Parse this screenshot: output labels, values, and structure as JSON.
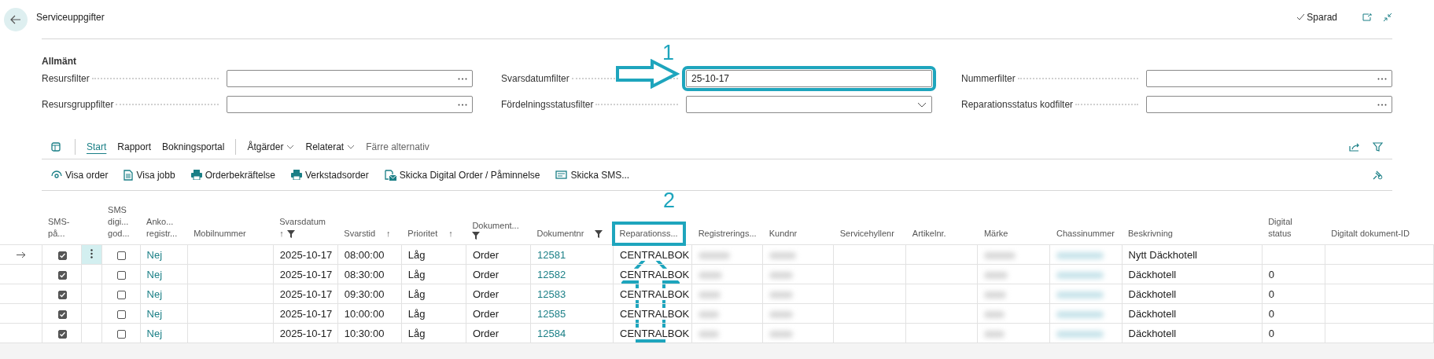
{
  "header": {
    "title": "Serviceuppgifter",
    "status": "Sparad"
  },
  "filters": {
    "group_title": "Allmänt",
    "fields": [
      {
        "label": "Resursfilter",
        "kind": "lookup",
        "highlighted": false
      },
      {
        "label": "Svarsdatumfilter",
        "value": "25-10-17",
        "kind": "text",
        "highlighted": true
      },
      {
        "label": "Nummerfilter",
        "kind": "lookup",
        "highlighted": false
      },
      {
        "label": "Resursgruppfilter",
        "kind": "lookup",
        "highlighted": false
      },
      {
        "label": "Fördelningsstatusfilter",
        "kind": "dropdown",
        "highlighted": false
      },
      {
        "label": "Reparationsstatus kodfilter",
        "kind": "lookup",
        "highlighted": false
      }
    ]
  },
  "nav": [
    {
      "label": "Start",
      "kind": "tab",
      "selected": true
    },
    {
      "label": "Rapport",
      "kind": "tab",
      "selected": false
    },
    {
      "label": "Bokningsportal",
      "kind": "tab",
      "selected": false
    },
    {
      "label": "Åtgärder",
      "kind": "menu",
      "selected": false
    },
    {
      "label": "Relaterat",
      "kind": "menu",
      "selected": false
    },
    {
      "label": "Färre alternativ",
      "kind": "toggle",
      "selected": false
    }
  ],
  "actions": [
    "Visa order",
    "Visa jobb",
    "Orderbekräftelse",
    "Verkstadsorder",
    "Skicka Digital Order / Påminnelse",
    "Skicka SMS..."
  ],
  "table": {
    "columns": [
      {
        "lines": [
          "SMS-",
          "på..."
        ],
        "kind": "check",
        "filter": false,
        "highlighted": false
      },
      {
        "lines": [
          "SMS",
          "digi...",
          "god..."
        ],
        "kind": "check",
        "filter": false,
        "highlighted": false
      },
      {
        "lines": [
          "Anko...",
          "registr..."
        ],
        "kind": "link",
        "filter": false,
        "highlighted": false
      },
      {
        "lines": [
          "Mobilnummer"
        ],
        "kind": "text",
        "filter": false,
        "highlighted": false
      },
      {
        "lines": [
          "Svarsdatum"
        ],
        "sort": "↑",
        "kind": "text",
        "filter": true,
        "highlighted": false
      },
      {
        "lines": [
          "Svarstid"
        ],
        "sort": "↑",
        "kind": "text",
        "filter": false,
        "highlighted": false
      },
      {
        "lines": [
          "Prioritet"
        ],
        "sort": "↑",
        "kind": "text",
        "filter": false,
        "highlighted": false
      },
      {
        "lines": [
          "Dokument..."
        ],
        "kind": "text",
        "filter": true,
        "highlighted": false
      },
      {
        "lines": [
          "Dokumentnr"
        ],
        "kind": "link",
        "filter": true,
        "highlighted": false
      },
      {
        "lines": [
          "Reparationss..."
        ],
        "kind": "text",
        "filter": false,
        "highlighted": true
      },
      {
        "lines": [
          "Registrerings..."
        ],
        "kind": "blurred",
        "filter": false,
        "highlighted": false
      },
      {
        "lines": [
          "Kundnr"
        ],
        "kind": "blurred",
        "filter": false,
        "highlighted": false
      },
      {
        "lines": [
          "Servicehyllenr"
        ],
        "kind": "text",
        "filter": false,
        "highlighted": false
      },
      {
        "lines": [
          "Artikelnr."
        ],
        "kind": "text",
        "filter": false,
        "highlighted": false
      },
      {
        "lines": [
          "Märke"
        ],
        "kind": "blurred",
        "filter": false,
        "highlighted": false
      },
      {
        "lines": [
          "Chassinummer"
        ],
        "kind": "blurred_link",
        "filter": false,
        "highlighted": false
      },
      {
        "lines": [
          "Beskrivning"
        ],
        "kind": "text",
        "filter": false,
        "highlighted": false
      },
      {
        "lines": [
          "Digital",
          "status"
        ],
        "kind": "text",
        "filter": false,
        "highlighted": false
      },
      {
        "lines": [
          "Digitalt dokument-ID"
        ],
        "kind": "text",
        "filter": false,
        "highlighted": false
      }
    ],
    "rows": [
      {
        "selected": true,
        "cells": [
          true,
          false,
          "Nej",
          null,
          "2025-10-17",
          "08:00:00",
          "Låg",
          "Order",
          "12581",
          "CENTRALBOK",
          null,
          null,
          null,
          null,
          null,
          null,
          "Nytt Däckhotell",
          null,
          null
        ]
      },
      {
        "selected": false,
        "cells": [
          true,
          false,
          "Nej",
          null,
          "2025-10-17",
          "08:30:00",
          "Låg",
          "Order",
          "12582",
          "CENTRALBOK",
          null,
          null,
          null,
          null,
          null,
          null,
          "Däckhotell",
          "0",
          null
        ]
      },
      {
        "selected": false,
        "cells": [
          true,
          false,
          "Nej",
          null,
          "2025-10-17",
          "09:30:00",
          "Låg",
          "Order",
          "12583",
          "CENTRALBOK",
          null,
          null,
          null,
          null,
          null,
          null,
          "Däckhotell",
          "0",
          null
        ]
      },
      {
        "selected": false,
        "cells": [
          true,
          false,
          "Nej",
          null,
          "2025-10-17",
          "10:00:00",
          "Låg",
          "Order",
          "12585",
          "CENTRALBOK",
          null,
          null,
          null,
          null,
          null,
          null,
          "Däckhotell",
          "0",
          null
        ]
      },
      {
        "selected": false,
        "cells": [
          true,
          false,
          "Nej",
          null,
          "2025-10-17",
          "10:30:00",
          "Låg",
          "Order",
          "12584",
          "CENTRALBOK",
          null,
          null,
          null,
          null,
          null,
          null,
          "Däckhotell",
          "0",
          null
        ]
      }
    ]
  },
  "annotations": [
    {
      "label": "1"
    },
    {
      "label": "2"
    }
  ]
}
